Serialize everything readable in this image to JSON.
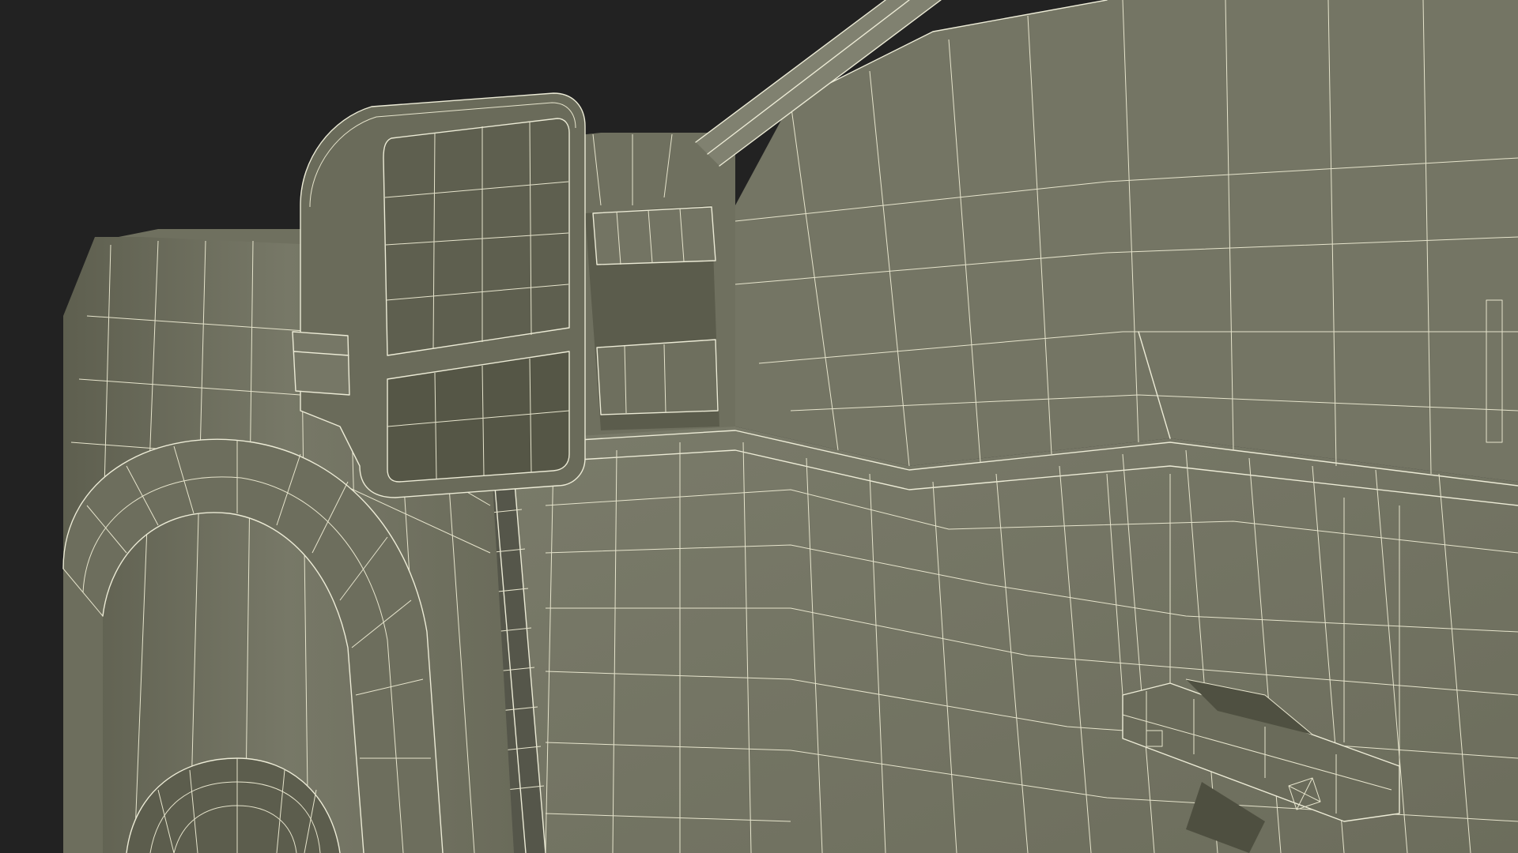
{
  "scene": {
    "background_color": "#222222",
    "surface_color": "#767766",
    "surface_shadow_color": "#5f604f",
    "surface_dark_color": "#4e4f40",
    "wire_color": "#ecebd6",
    "subject": "wireframe-render-truck-side-mirror-door"
  }
}
